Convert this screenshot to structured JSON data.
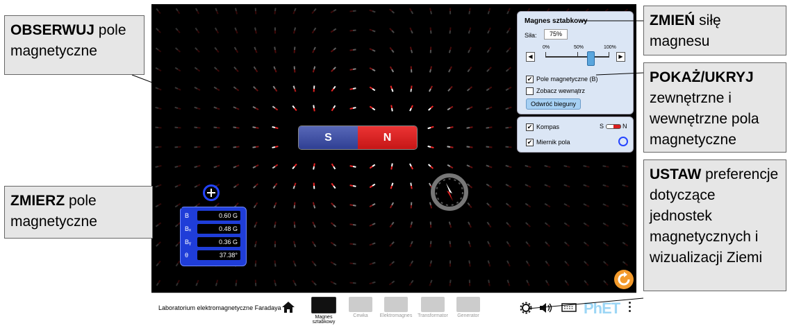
{
  "callouts": {
    "observe": {
      "bold": "OBSERWUJ",
      "text": " pole magnetyczne"
    },
    "measure": {
      "bold": "ZMIERZ",
      "text": " pole magnetyczne"
    },
    "change": {
      "bold": "ZMIEŃ",
      "text": " siłę magnesu"
    },
    "show": {
      "bold": "POKAŻ/UKRYJ",
      "text": " zewnętrzne i wewnętrzne pola magnetyczne"
    },
    "set": {
      "bold": "USTAW",
      "text": " preferencje dotyczące jednostek magnetycznych i wizualizacji Ziemi"
    }
  },
  "magnet": {
    "south": "S",
    "north": "N"
  },
  "magnet_panel": {
    "title": "Magnes sztabkowy",
    "strength_label": "Siła:",
    "strength_value": "75%",
    "strength_fraction": 0.75,
    "ticks": [
      "0%",
      "50%",
      "100%"
    ],
    "field_checkbox": "Pole magnetyczne (B)",
    "field_checked": true,
    "inside_checkbox": "Zobacz wewnątrz",
    "inside_checked": false,
    "flip_button": "Odwróć bieguny"
  },
  "tools_panel": {
    "compass_label": "Kompas",
    "compass_checked": true,
    "compass_s": "S",
    "compass_n": "N",
    "meter_label": "Miernik pola",
    "meter_checked": true
  },
  "field_meter": {
    "rows": [
      {
        "label": "B",
        "value": "0.60 G"
      },
      {
        "label": "Bₓ",
        "value": "0.48 G"
      },
      {
        "label": "Bᵧ",
        "value": "0.36 G"
      },
      {
        "label": "θ",
        "value": "37.38°"
      }
    ]
  },
  "navbar": {
    "title": "Laboratorium elektromagnetyczne Faradaya",
    "screens": [
      {
        "label": "Magnes sztabkowy",
        "active": true
      },
      {
        "label": "Cewka",
        "active": false
      },
      {
        "label": "Elektromagnes",
        "active": false
      },
      {
        "label": "Transformator",
        "active": false
      },
      {
        "label": "Generator",
        "active": false
      }
    ],
    "brand": "PhET"
  },
  "colors": {
    "north": "#d81e1e",
    "south": "#2f3f93",
    "panel": "#dbe6f5",
    "accent": "#1f3dd8"
  }
}
